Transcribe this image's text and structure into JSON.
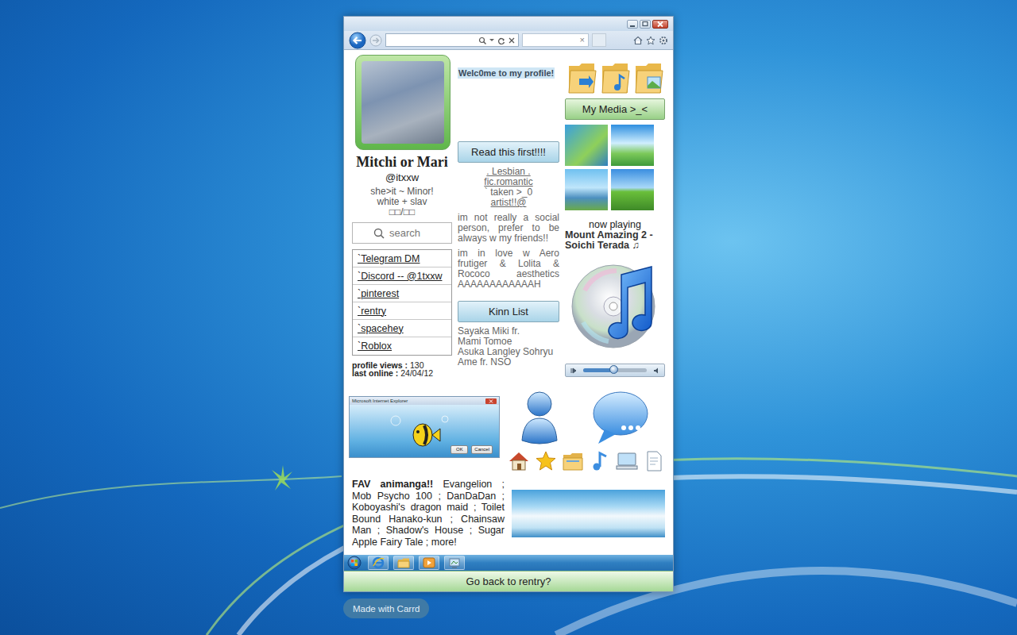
{
  "browser": {
    "tab_close": "×"
  },
  "profile": {
    "name": "Mitchi or Mari",
    "handle": "@itxxw",
    "bio": [
      "she>it ~ Minor!",
      "white + slav",
      "□□/□□"
    ]
  },
  "search": {
    "placeholder": "search"
  },
  "links": [
    {
      "label": "`Telegram DM"
    },
    {
      "label": "`Discord -- @1txxw"
    },
    {
      "label": "`pinterest"
    },
    {
      "label": "`rentry"
    },
    {
      "label": "`spacehey"
    },
    {
      "label": "`Roblox"
    }
  ],
  "stats": [
    {
      "label": "profile views :",
      "value": "130"
    },
    {
      "label": "last online :",
      "value": "24/04/12"
    }
  ],
  "welcome": "Welc0me to my profile!",
  "read_button": "Read this first!!!!",
  "tags": [
    {
      "text": ". Lesbian .",
      "underlined": true
    },
    {
      "text": "fic.romantic",
      "underlined": true
    },
    {
      "text": "` taken >_0",
      "underlined": false
    },
    {
      "text": "artist!!@",
      "underlined": true
    }
  ],
  "about": [
    "im not really a social person, prefer to be always w my friends!!",
    "im in love w Aero frutiger & Lolita & Rococo aesthetics AAAAAAAAAAAAH"
  ],
  "kinn_button": "Kinn List",
  "kinn_list": [
    "Sayaka Miki fr.",
    "Mami Tomoe",
    "Asuka Langley Sohryu",
    "Ame fr. NSO"
  ],
  "media_button": "My Media >_<",
  "now_playing": {
    "label": "now playing",
    "track": "Mount Amazing 2 - Soichi Terada ♫"
  },
  "player": {
    "level": 0.48
  },
  "dialog": {
    "title": "Microsoft Internet Explorer",
    "buttons": [
      "OK",
      "Cancel"
    ]
  },
  "favorites": {
    "label": "FAV animanga!!",
    "text": "Evangelion ; Mob Psycho 100 ; DanDaDan ; Koboyashi's dragon maid ; Toilet Bound Hanako-kun ; Chainsaw Man ; Shadow's House ; Sugar Apple Fairy Tale ; more!"
  },
  "back_button": "Go back to rentry?",
  "badge": "Made with Carrd"
}
